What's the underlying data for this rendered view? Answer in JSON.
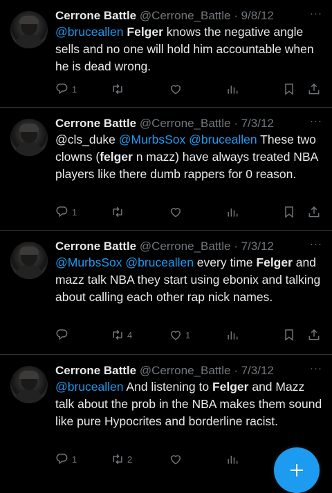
{
  "tweets": [
    {
      "name": "Cerrone Battle",
      "handle": "@Cerrone_Battle",
      "date": "9/8/12",
      "more": "···",
      "segments": [
        {
          "t": "@bruceallen",
          "k": "mention"
        },
        {
          "t": " ",
          "k": "plain"
        },
        {
          "t": "Felger",
          "k": "bold"
        },
        {
          "t": " knows the negative angle sells and no one will hold him accountable when he is dead wrong.",
          "k": "plain"
        }
      ],
      "replies": "1",
      "retweets": "",
      "likes": ""
    },
    {
      "name": "Cerrone Battle",
      "handle": "@Cerrone_Battle",
      "date": "7/3/12",
      "more": "···",
      "segments": [
        {
          "t": "@cls_duke ",
          "k": "plain"
        },
        {
          "t": "@MurbsSox",
          "k": "mention"
        },
        {
          "t": " ",
          "k": "plain"
        },
        {
          "t": "@bruceallen",
          "k": "mention"
        },
        {
          "t": " These two clowns (",
          "k": "plain"
        },
        {
          "t": "felger",
          "k": "bold"
        },
        {
          "t": " n mazz) have always treated NBA players like there dumb rappers for 0 reason.",
          "k": "plain"
        }
      ],
      "replies": "1",
      "retweets": "",
      "likes": ""
    },
    {
      "name": "Cerrone Battle",
      "handle": "@Cerrone_Battle",
      "date": "7/3/12",
      "more": "···",
      "segments": [
        {
          "t": "@MurbsSox",
          "k": "mention"
        },
        {
          "t": " ",
          "k": "plain"
        },
        {
          "t": "@bruceallen",
          "k": "mention"
        },
        {
          "t": " every time ",
          "k": "plain"
        },
        {
          "t": "Felger",
          "k": "bold"
        },
        {
          "t": " and mazz talk NBA they start using ebonix and talking about calling each other rap nick names.",
          "k": "plain"
        }
      ],
      "replies": "",
      "retweets": "4",
      "likes": "1"
    },
    {
      "name": "Cerrone Battle",
      "handle": "@Cerrone_Battle",
      "date": "7/3/12",
      "more": "···",
      "segments": [
        {
          "t": "@bruceallen",
          "k": "mention"
        },
        {
          "t": " And listening to ",
          "k": "plain"
        },
        {
          "t": "Felger",
          "k": "bold"
        },
        {
          "t": " and Mazz talk about the prob in the NBA makes them sound like pure Hypocrites and borderline racist.",
          "k": "plain"
        }
      ],
      "replies": "1",
      "retweets": "2",
      "likes": ""
    }
  ],
  "colors": {
    "background": "#000000",
    "text": "#e7e9ea",
    "muted": "#71767b",
    "accent": "#1d9bf0"
  },
  "icons": [
    "reply-icon",
    "retweet-icon",
    "like-icon",
    "views-icon",
    "bookmark-icon",
    "share-icon",
    "compose-icon"
  ]
}
